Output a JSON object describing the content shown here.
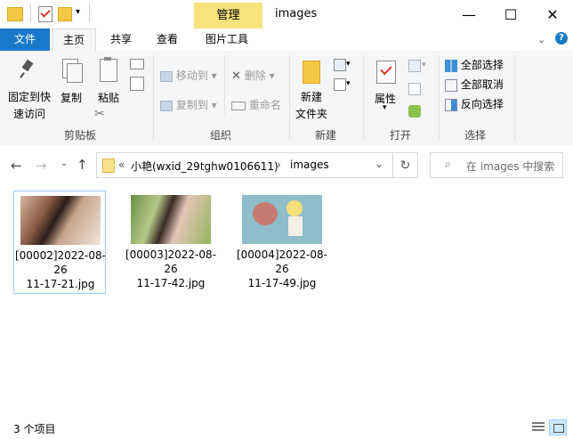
{
  "window": {
    "context_tab": "管理",
    "title": "images",
    "min": "—",
    "max": "☐",
    "close": "✕"
  },
  "ribbon_tabs": {
    "file": "文件",
    "home": "主页",
    "share": "共享",
    "view": "查看",
    "picture_tools": "图片工具"
  },
  "clipboard": {
    "pin_line1": "固定到快",
    "pin_line2": "速访问",
    "copy": "复制",
    "paste": "粘贴",
    "label": "剪贴板"
  },
  "organize": {
    "move_to": "移动到",
    "copy_to": "复制到",
    "delete": "删除",
    "rename": "重命名",
    "label": "组织"
  },
  "new": {
    "new_folder_line1": "新建",
    "new_folder_line2": "文件夹",
    "label": "新建"
  },
  "open": {
    "properties": "属性",
    "label": "打开"
  },
  "select": {
    "select_all": "全部选择",
    "select_none": "全部取消",
    "invert": "反向选择",
    "label": "选择"
  },
  "address": {
    "prefix": "«",
    "parent": "小艳(wxid_29tghw0106611)",
    "current": "images"
  },
  "search": {
    "placeholder": "在 images 中搜索"
  },
  "files": [
    {
      "name": "[00002]2022-08-\n26\n11-17-21.jpg"
    },
    {
      "name": "[00003]2022-08-\n26\n11-17-42.jpg"
    },
    {
      "name": "[00004]2022-08-\n26\n11-17-49.jpg"
    }
  ],
  "status": {
    "count": "3 个项目"
  },
  "colors": {
    "accent": "#1979ca",
    "context_tab": "#f7e27c",
    "selection_border": "#99d1ff"
  }
}
